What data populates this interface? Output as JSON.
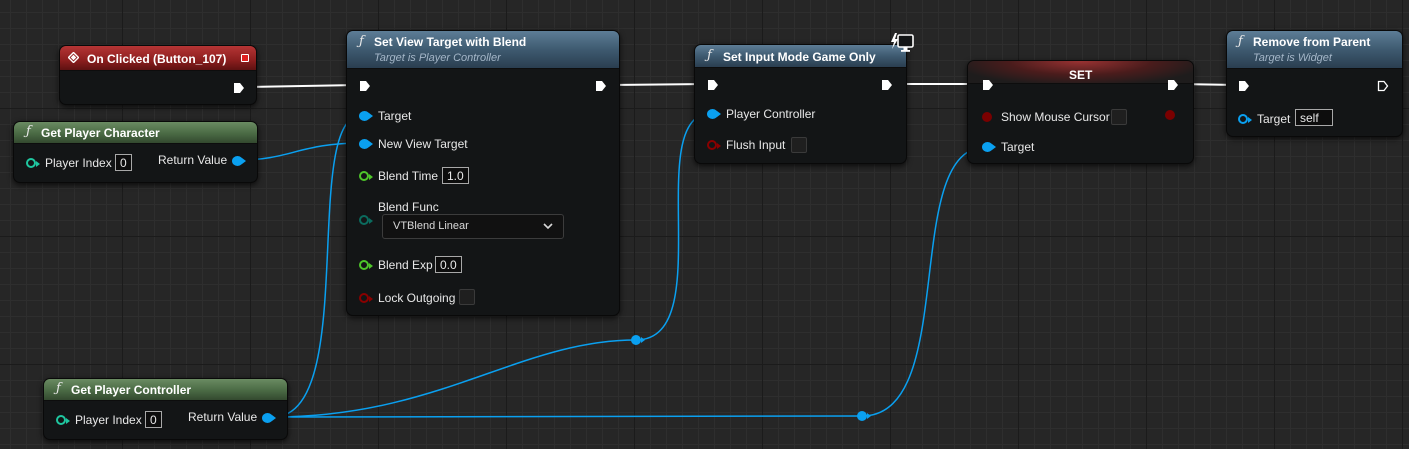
{
  "nodes": {
    "on_clicked": {
      "title": "On Clicked (Button_107)"
    },
    "get_player_character": {
      "title": "Get Player Character",
      "player_index_label": "Player Index",
      "player_index_value": "0",
      "return_label": "Return Value"
    },
    "set_view_target": {
      "title": "Set View Target with Blend",
      "subtitle": "Target is Player Controller",
      "pins": {
        "target": "Target",
        "new_view_target": "New View Target",
        "blend_time": "Blend Time",
        "blend_time_value": "1.0",
        "blend_func": "Blend Func",
        "blend_func_value": "VTBlend Linear",
        "blend_exp": "Blend Exp",
        "blend_exp_value": "0.0",
        "lock_outgoing": "Lock Outgoing"
      }
    },
    "set_input_mode": {
      "title": "Set Input Mode Game Only",
      "pins": {
        "player_controller": "Player Controller",
        "flush_input": "Flush Input"
      }
    },
    "set_node": {
      "title": "SET",
      "pins": {
        "show_mouse_cursor": "Show Mouse Cursor",
        "target": "Target"
      }
    },
    "remove_from_parent": {
      "title": "Remove from Parent",
      "subtitle": "Target is Widget",
      "pins": {
        "target": "Target",
        "target_value": "self"
      }
    },
    "get_player_controller": {
      "title": "Get Player Controller",
      "player_index_label": "Player Index",
      "player_index_value": "0",
      "return_label": "Return Value"
    }
  },
  "colors": {
    "exec_wire": "#ffffff",
    "object_pin": "#0aa0f0",
    "integer_pin": "#1fc7a0",
    "float_pin": "#4ec62a",
    "bool_pin": "#8a0000",
    "enum_pin": "#0b6b5e",
    "function_header": "#3e5a70",
    "pure_header": "#4a6a44",
    "event_header": "#8c1e1e"
  },
  "icons": {
    "function": "function-f-icon",
    "event": "event-diamond-icon",
    "delegate": "stop-square-icon",
    "client_only": "monitor-lightning-icon",
    "exec": "exec-arrow-icon"
  }
}
